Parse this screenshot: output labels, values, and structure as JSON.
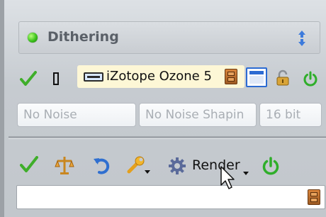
{
  "dithering": {
    "title": "Dithering",
    "status_color": "#3bc21c"
  },
  "plugin": {
    "name": "iZotope Ozone 5"
  },
  "selects": {
    "noise": "No Noise",
    "noise_shaping": "No Noise Shapin",
    "bit_depth": "16 bit"
  },
  "render": {
    "label": "Render"
  },
  "icons": {
    "enabled": "check-icon",
    "bypass": "box-icon",
    "plugin": "plugin-card-icon",
    "browse": "folder-icon",
    "window": "window-icon",
    "lock": "lock-icon",
    "power": "power-icon",
    "balance": "balance-icon",
    "undo": "undo-icon",
    "wrench": "wrench-icon",
    "gear": "gear-icon",
    "cursor": "mouse-cursor-icon"
  }
}
